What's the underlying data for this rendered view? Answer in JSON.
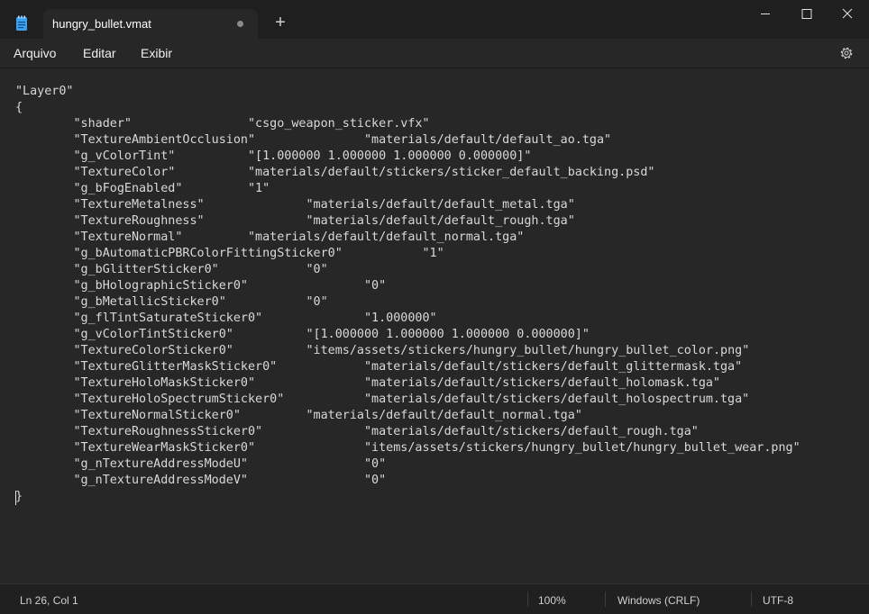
{
  "window": {
    "tab_title": "hungry_bullet.vmat",
    "new_tab_symbol": "+",
    "icons": [
      "notepad-icon",
      "unsaved-dot-icon",
      "minimize-icon",
      "maximize-icon",
      "close-icon",
      "gear-icon"
    ]
  },
  "menu": {
    "file": "Arquivo",
    "edit": "Editar",
    "view": "Exibir"
  },
  "editor": {
    "lines": [
      "\"Layer0\"",
      "{",
      "\t\"shader\"\t\t\"csgo_weapon_sticker.vfx\"",
      "\t\"TextureAmbientOcclusion\"\t\t\"materials/default/default_ao.tga\"",
      "\t\"g_vColorTint\"\t\t\"[1.000000 1.000000 1.000000 0.000000]\"",
      "\t\"TextureColor\"\t\t\"materials/default/stickers/sticker_default_backing.psd\"",
      "\t\"g_bFogEnabled\"\t\t\"1\"",
      "\t\"TextureMetalness\"\t\t\"materials/default/default_metal.tga\"",
      "\t\"TextureRoughness\"\t\t\"materials/default/default_rough.tga\"",
      "\t\"TextureNormal\"\t\t\"materials/default/default_normal.tga\"",
      "\t\"g_bAutomaticPBRColorFittingSticker0\"\t\t\"1\"",
      "\t\"g_bGlitterSticker0\"\t\t\"0\"",
      "\t\"g_bHolographicSticker0\"\t\t\"0\"",
      "\t\"g_bMetallicSticker0\"\t\t\"0\"",
      "\t\"g_flTintSaturateSticker0\"\t\t\"1.000000\"",
      "\t\"g_vColorTintSticker0\"\t\t\"[1.000000 1.000000 1.000000 0.000000]\"",
      "\t\"TextureColorSticker0\"\t\t\"items/assets/stickers/hungry_bullet/hungry_bullet_color.png\"",
      "\t\"TextureGlitterMaskSticker0\"\t\t\"materials/default/stickers/default_glittermask.tga\"",
      "\t\"TextureHoloMaskSticker0\"\t\t\"materials/default/stickers/default_holomask.tga\"",
      "\t\"TextureHoloSpectrumSticker0\"\t\t\"materials/default/stickers/default_holospectrum.tga\"",
      "\t\"TextureNormalSticker0\"\t\t\"materials/default/default_normal.tga\"",
      "\t\"TextureRoughnessSticker0\"\t\t\"materials/default/stickers/default_rough.tga\"",
      "\t\"TextureWearMaskSticker0\"\t\t\"items/assets/stickers/hungry_bullet/hungry_bullet_wear.png\"",
      "\t\"g_nTextureAddressModeU\"\t\t\"0\"",
      "\t\"g_nTextureAddressModeV\"\t\t\"0\"",
      "}"
    ]
  },
  "status": {
    "position": "Ln 26, Col 1",
    "zoom": "100%",
    "line_ending": "Windows (CRLF)",
    "encoding": "UTF-8"
  }
}
